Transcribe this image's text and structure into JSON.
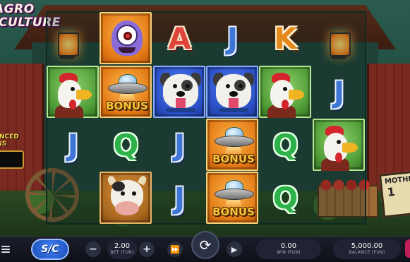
{
  "game": {
    "logo_line1": "AGRO",
    "logo_line2": "CULTURE",
    "side_panel_title_line1": "ANCED",
    "side_panel_title_line2": "INS",
    "sign_line1": "MOTHE",
    "sign_line2": "1",
    "bonus_label": "BONUS"
  },
  "reels": [
    [
      "rooster",
      "J",
      "cow"
    ],
    [
      "alien",
      "bonus",
      "Q",
      "cow"
    ],
    [
      "A",
      "bulldog",
      "J",
      "J"
    ],
    [
      "J",
      "bulldog",
      "bonus",
      "bonus"
    ],
    [
      "K",
      "rooster",
      "Q",
      "Q"
    ],
    [
      "J",
      "rooster"
    ]
  ],
  "controls": {
    "sc_label": "S/C",
    "bet_value": "2.00",
    "bet_label": "BET (FUN)",
    "win_value": "0.00",
    "win_label": "WIN (FUN)",
    "balance_value": "5,000.00",
    "balance_label": "BALANCE (FUN)",
    "minus_symbol": "−",
    "plus_symbol": "+",
    "fast_symbol": "⏩",
    "spin_symbol": "⟳",
    "autoplay_symbol": "▶"
  },
  "colors": {
    "orange_tile": "#e27713",
    "blue_tile": "#2a4fc5",
    "green_tile": "#4e9b36",
    "accent": "#c01f5a"
  }
}
